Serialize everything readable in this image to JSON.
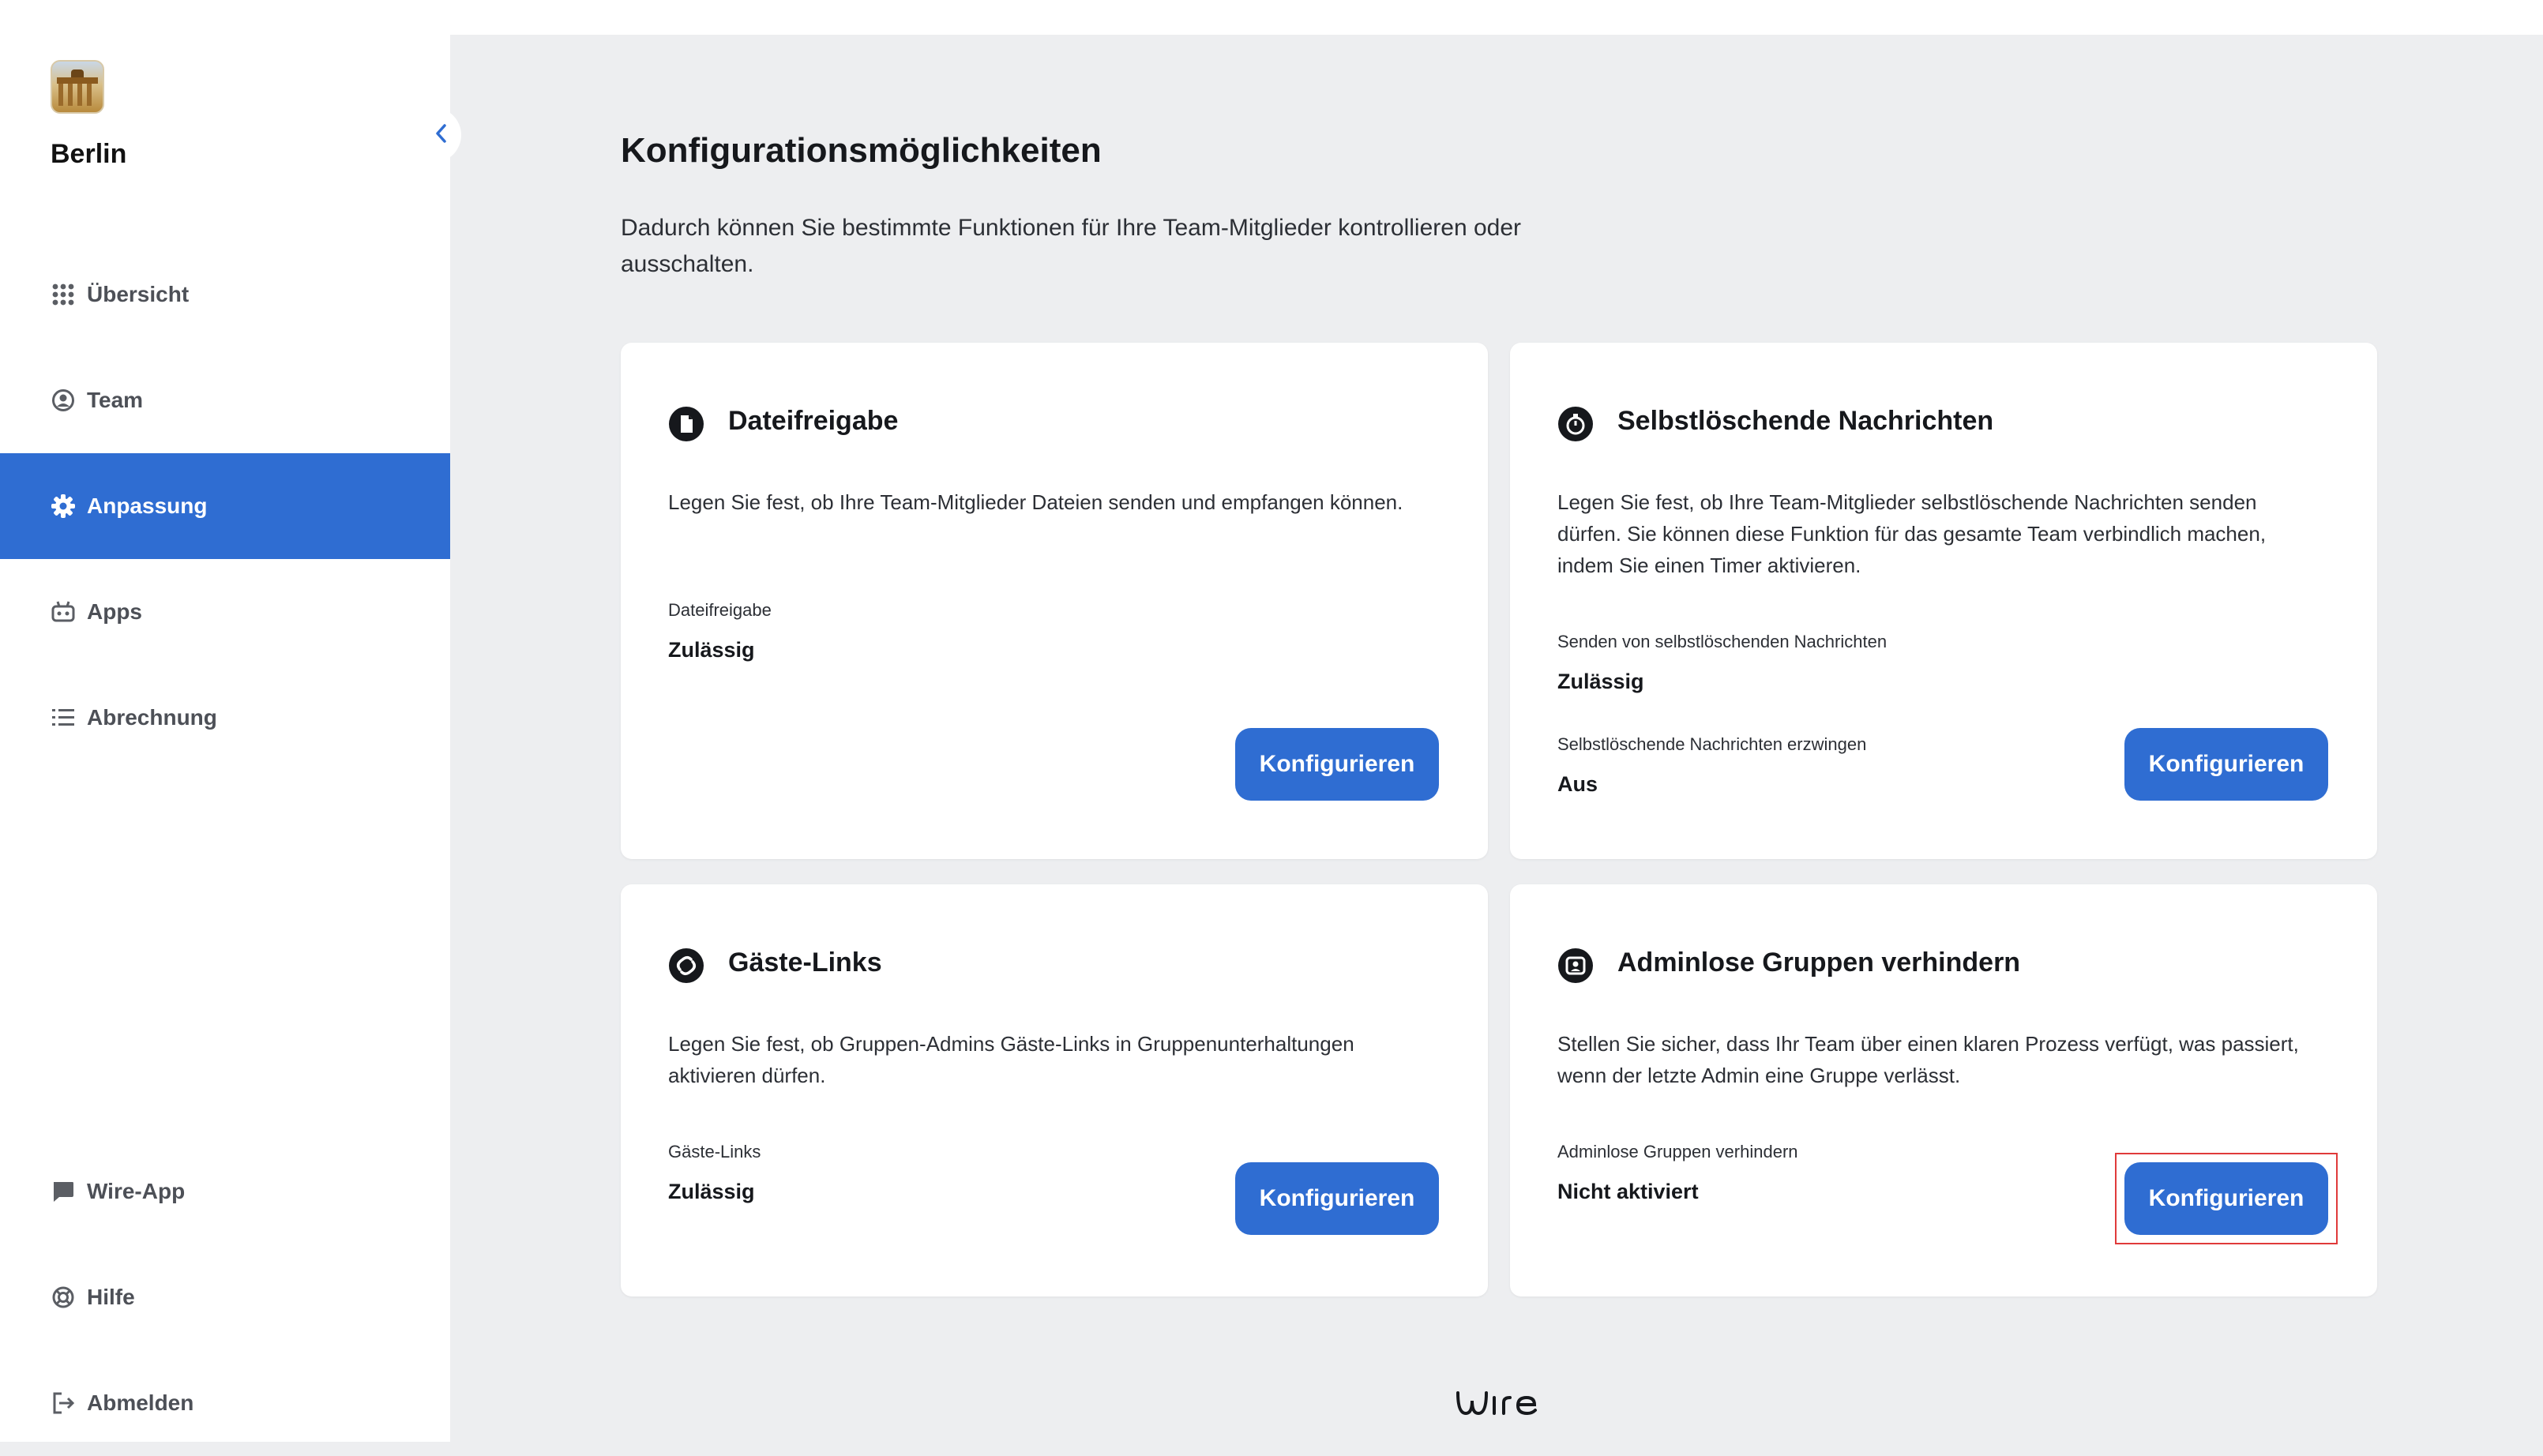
{
  "sidebar": {
    "team_name": "Berlin",
    "nav": [
      {
        "label": "Übersicht",
        "icon": "grid-icon"
      },
      {
        "label": "Team",
        "icon": "user-circle-icon"
      },
      {
        "label": "Anpassung",
        "icon": "gear-icon",
        "active": true
      },
      {
        "label": "Apps",
        "icon": "robot-icon"
      },
      {
        "label": "Abrechnung",
        "icon": "list-icon"
      }
    ],
    "bottom": [
      {
        "label": "Wire-App",
        "icon": "chat-bubble-icon"
      },
      {
        "label": "Hilfe",
        "icon": "lifebuoy-icon"
      },
      {
        "label": "Abmelden",
        "icon": "logout-icon"
      }
    ]
  },
  "main": {
    "title": "Konfigurationsmöglichkeiten",
    "description": "Dadurch können Sie bestimmte Funktionen für Ihre Team-Mitglieder kontrollieren oder ausschalten.",
    "cards": [
      {
        "title": "Dateifreigabe",
        "icon": "file-icon",
        "description": "Legen Sie fest, ob Ihre Team-Mitglieder Dateien senden und empfangen können.",
        "settings": [
          {
            "label": "Dateifreigabe",
            "value": "Zulässig"
          }
        ],
        "button": "Konfigurieren"
      },
      {
        "title": "Selbstlöschende Nachrichten",
        "icon": "timer-icon",
        "description": "Legen Sie fest, ob Ihre Team-Mitglieder selbstlöschende Nachrichten senden dürfen. Sie können diese Funktion für das gesamte Team verbindlich machen, indem Sie einen Timer aktivieren.",
        "settings": [
          {
            "label": "Senden von selbstlöschenden Nachrichten",
            "value": "Zulässig"
          },
          {
            "label": "Selbstlöschende Nachrichten erzwingen",
            "value": "Aus"
          }
        ],
        "button": "Konfigurieren"
      },
      {
        "title": "Gäste-Links",
        "icon": "link-icon",
        "description": "Legen Sie fest, ob Gruppen-Admins Gäste-Links in Gruppenunterhaltungen aktivieren dürfen.",
        "settings": [
          {
            "label": "Gäste-Links",
            "value": "Zulässig"
          }
        ],
        "button": "Konfigurieren"
      },
      {
        "title": "Adminlose Gruppen verhindern",
        "icon": "admin-group-icon",
        "description": "Stellen Sie sicher, dass Ihr Team über einen klaren Prozess verfügt, was passiert, wenn der letzte Admin eine Gruppe verlässt.",
        "settings": [
          {
            "label": "Adminlose Gruppen verhindern",
            "value": "Nicht aktiviert"
          }
        ],
        "button": "Konfigurieren"
      }
    ]
  },
  "footer": {
    "logo_icon": "wire-logo-icon"
  },
  "colors": {
    "accent": "#2f6dd2",
    "background": "#edeef0",
    "highlight": "#e03a3a"
  }
}
